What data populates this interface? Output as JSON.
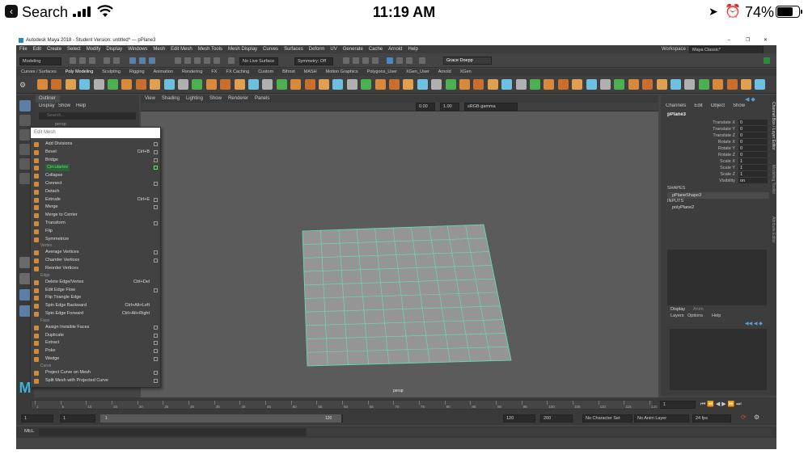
{
  "ios": {
    "back_label": "Search",
    "time": "11:19 AM",
    "battery": "74%",
    "battery_level": 0.74
  },
  "window": {
    "title": "Autodesk Maya 2018 - Student Version: untitled*   ---   pPlane3",
    "controls": [
      "–",
      "❐",
      "✕"
    ]
  },
  "menubar": {
    "items": [
      "File",
      "Edit",
      "Create",
      "Select",
      "Modify",
      "Display",
      "Windows",
      "Mesh",
      "Edit Mesh",
      "Mesh Tools",
      "Mesh Display",
      "Curves",
      "Surfaces",
      "Deform",
      "UV",
      "Generate",
      "Cache",
      "Arnold",
      "Help"
    ],
    "workspace_label": "Workspace :",
    "workspace_value": "Maya Classic*"
  },
  "statusline": {
    "mode": "Modeling",
    "live_surface": "No Live Surface",
    "symmetry": "Symmetry: Off",
    "user": "Grace Doepp"
  },
  "shelf": {
    "tabs": [
      "Curves / Surfaces",
      "Poly Modeling",
      "Sculpting",
      "Rigging",
      "Animation",
      "Rendering",
      "FX",
      "FX Caching",
      "Custom",
      "Bifrost",
      "MASH",
      "Motion Graphics",
      "Polygons_User",
      "XGen_User",
      "Arnold",
      "XGen"
    ],
    "active_tab": "Poly Modeling",
    "icon_colors": [
      "#d88a3a",
      "#c96f2b",
      "#e0a050",
      "#6ec0e0",
      "#b0b0b0",
      "#4caf50"
    ]
  },
  "outliner": {
    "title": "Outliner",
    "menu": [
      "Display",
      "Show",
      "Help"
    ],
    "search_placeholder": "Search...",
    "item": "persp"
  },
  "edit_mesh_menu": {
    "title": "Edit Mesh",
    "groups": [
      {
        "header": "",
        "items": [
          {
            "label": "Add Divisions",
            "shortcut": "",
            "option": true
          },
          {
            "label": "Bevel",
            "shortcut": "Ctrl+B",
            "option": true
          },
          {
            "label": "Bridge",
            "shortcut": "",
            "option": true
          },
          {
            "label": "Circularize",
            "shortcut": "",
            "option": true,
            "highlight": true
          },
          {
            "label": "Collapse",
            "shortcut": "",
            "option": false
          },
          {
            "label": "Connect",
            "shortcut": "",
            "option": true
          },
          {
            "label": "Detach",
            "shortcut": "",
            "option": false
          },
          {
            "label": "Extrude",
            "shortcut": "Ctrl+E",
            "option": true
          },
          {
            "label": "Merge",
            "shortcut": "",
            "option": true
          },
          {
            "label": "Merge to Center",
            "shortcut": "",
            "option": false
          },
          {
            "label": "Transform",
            "shortcut": "",
            "option": true
          }
        ]
      },
      {
        "header": "",
        "items": [
          {
            "label": "Flip",
            "shortcut": "",
            "option": false
          },
          {
            "label": "Symmetrize",
            "shortcut": "",
            "option": false
          }
        ]
      },
      {
        "header": "Vertex",
        "items": [
          {
            "label": "Average Vertices",
            "shortcut": "",
            "option": true
          },
          {
            "label": "Chamfer Vertices",
            "shortcut": "",
            "option": true
          },
          {
            "label": "Reorder Vertices",
            "shortcut": "",
            "option": false
          }
        ]
      },
      {
        "header": "Edge",
        "items": [
          {
            "label": "Delete Edge/Vertex",
            "shortcut": "Ctrl+Del",
            "option": false
          },
          {
            "label": "Edit Edge Flow",
            "shortcut": "",
            "option": true
          },
          {
            "label": "Flip Triangle Edge",
            "shortcut": "",
            "option": false
          },
          {
            "label": "Spin Edge Backward",
            "shortcut": "Ctrl+Alt+Left",
            "option": false
          },
          {
            "label": "Spin Edge Forward",
            "shortcut": "Ctrl+Alt+Right",
            "option": false
          }
        ]
      },
      {
        "header": "Face",
        "items": [
          {
            "label": "Assign Invisible Faces",
            "shortcut": "",
            "option": true
          },
          {
            "label": "Duplicate",
            "shortcut": "",
            "option": true
          },
          {
            "label": "Extract",
            "shortcut": "",
            "option": true
          },
          {
            "label": "Poke",
            "shortcut": "",
            "option": true
          },
          {
            "label": "Wedge",
            "shortcut": "",
            "option": true
          }
        ]
      },
      {
        "header": "Curve",
        "items": [
          {
            "label": "Project Curve on Mesh",
            "shortcut": "",
            "option": true
          },
          {
            "label": "Split Mesh with Projected Curve",
            "shortcut": "",
            "option": true
          }
        ]
      }
    ]
  },
  "viewport": {
    "menu": [
      "View",
      "Shading",
      "Lighting",
      "Show",
      "Renderer",
      "Panels"
    ],
    "near_value": "0.00",
    "far_value": "1.00",
    "color_space": "sRGB gamma",
    "camera_label": "persp",
    "plane_fill": "#959595",
    "wire_color": "#5fe6b0"
  },
  "channel_box": {
    "menu": [
      "Channels",
      "Edit",
      "Object",
      "Show"
    ],
    "object": "pPlane3",
    "attributes": [
      {
        "name": "Translate X",
        "value": "0"
      },
      {
        "name": "Translate Y",
        "value": "0"
      },
      {
        "name": "Translate Z",
        "value": "0"
      },
      {
        "name": "Rotate X",
        "value": "0"
      },
      {
        "name": "Rotate Y",
        "value": "0"
      },
      {
        "name": "Rotate Z",
        "value": "0"
      },
      {
        "name": "Scale X",
        "value": "1"
      },
      {
        "name": "Scale Y",
        "value": "1"
      },
      {
        "name": "Scale Z",
        "value": "1"
      },
      {
        "name": "Visibility",
        "value": "on"
      }
    ],
    "shapes_header": "SHAPES",
    "shape": "pPlaneShape3",
    "inputs_header": "INPUTS",
    "input": "polyPlane2",
    "side_tabs": [
      "Channel Box / Layer Editor",
      "Modeling Toolkit",
      "Attribute Editor"
    ]
  },
  "layers": {
    "tabs": [
      "Display",
      "Anim"
    ],
    "menu": [
      "Layers",
      "Options",
      "Help"
    ]
  },
  "timeline": {
    "ticks": [
      "1",
      "5",
      "10",
      "15",
      "20",
      "25",
      "30",
      "35",
      "40",
      "45",
      "50",
      "55",
      "60",
      "65",
      "70",
      "75",
      "80",
      "85",
      "90",
      "95",
      "100",
      "105",
      "110",
      "115",
      "120"
    ],
    "current_frame": "1"
  },
  "range": {
    "start": "1",
    "start_inner": "1",
    "slider_start": "1",
    "slider_end": "120",
    "end_inner": "120",
    "end": "200",
    "character_set": "No Character Set",
    "anim_layer": "No Anim Layer",
    "fps": "24 fps"
  },
  "command_line": {
    "label": "MEL"
  }
}
